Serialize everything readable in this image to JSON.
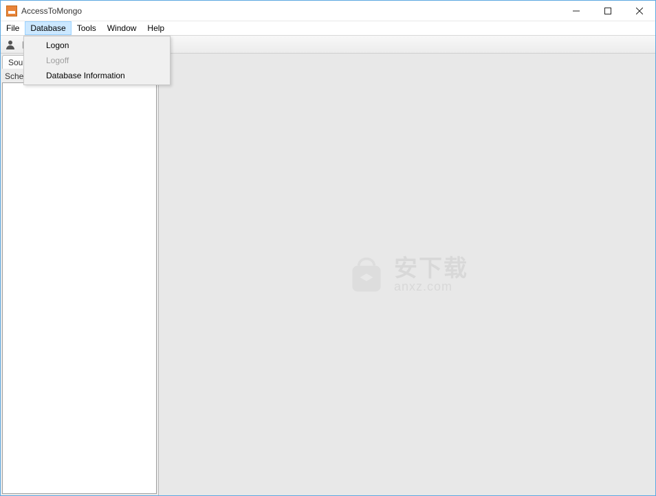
{
  "titlebar": {
    "app_name": "AccessToMongo"
  },
  "menubar": {
    "file": "File",
    "database": "Database",
    "tools": "Tools",
    "window": "Window",
    "help": "Help"
  },
  "database_menu": {
    "logon": "Logon",
    "logoff": "Logoff",
    "dbinfo": "Database Information"
  },
  "sidebar": {
    "tab_source": "Source",
    "schema_label": "Schema"
  },
  "watermark": {
    "cn": "安下载",
    "en": "anxz.com"
  }
}
